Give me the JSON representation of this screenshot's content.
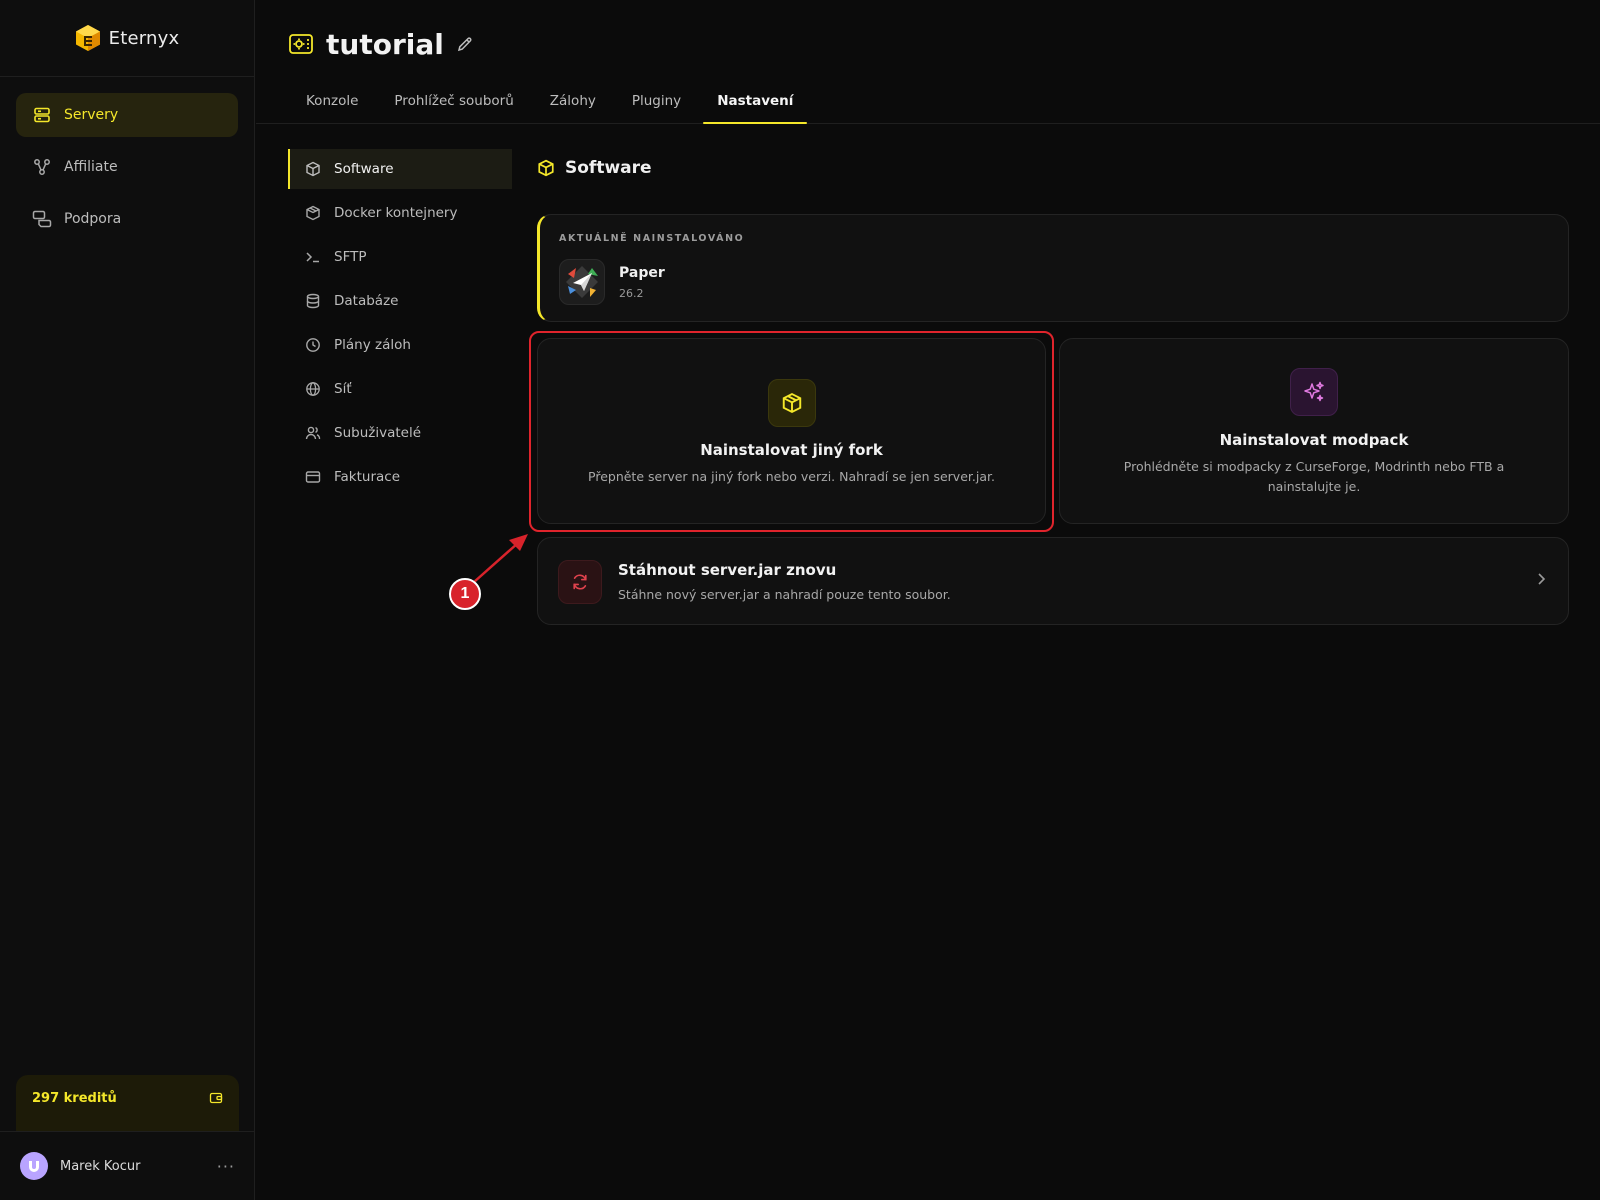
{
  "brand": {
    "name": "Eternyx"
  },
  "sidebar": {
    "items": [
      {
        "label": "Servery",
        "icon": "server-icon"
      },
      {
        "label": "Affiliate",
        "icon": "share-nodes-icon"
      },
      {
        "label": "Podpora",
        "icon": "chat-bubbles-icon"
      }
    ],
    "credits": "297 kreditů",
    "user": {
      "name": "Marek Kocur",
      "more": "···"
    }
  },
  "header": {
    "title": "tutorial",
    "tabs": [
      {
        "label": "Konzole"
      },
      {
        "label": "Prohlížeč souborů"
      },
      {
        "label": "Zálohy"
      },
      {
        "label": "Pluginy"
      },
      {
        "label": "Nastavení"
      }
    ]
  },
  "submenu": {
    "items": [
      {
        "label": "Software"
      },
      {
        "label": "Docker kontejnery"
      },
      {
        "label": "SFTP"
      },
      {
        "label": "Databáze"
      },
      {
        "label": "Plány záloh"
      },
      {
        "label": "Síť"
      },
      {
        "label": "Subuživatelé"
      },
      {
        "label": "Fakturace"
      }
    ]
  },
  "main": {
    "section_title": "Software",
    "current": {
      "label": "AKTUÁLNĚ NAINSTALOVÁNO",
      "name": "Paper",
      "version": "26.2"
    },
    "fork_card": {
      "title": "Nainstalovat jiný fork",
      "desc": "Přepněte server na jiný fork nebo verzi. Nahradí se jen server.jar."
    },
    "modpack_card": {
      "title": "Nainstalovat modpack",
      "desc": "Prohlédněte si modpacky z CurseForge, Modrinth nebo FTB a nainstalujte je."
    },
    "redownload": {
      "title": "Stáhnout server.jar znovu",
      "desc": "Stáhne nový server.jar a nahradí pouze tento soubor."
    }
  },
  "annotation": {
    "badge": "1"
  },
  "colors": {
    "accent": "#f4e72a",
    "highlight": "#e0242c",
    "modpack": "#e07ae0",
    "danger": "#e0424d"
  }
}
